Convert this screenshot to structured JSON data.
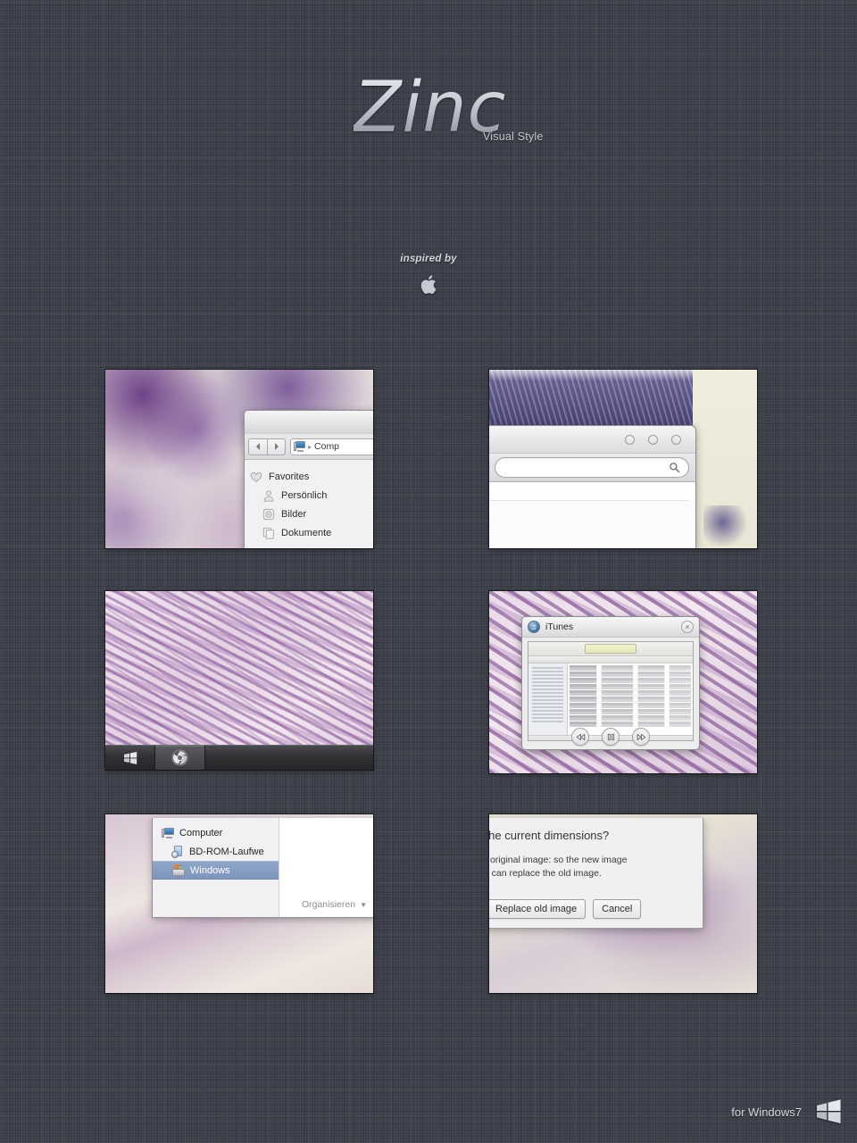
{
  "header": {
    "title": "Zinc",
    "subtitle": "Visual Style"
  },
  "inspired": {
    "label": "inspired by",
    "logo_icon": "apple-logo-icon"
  },
  "footer": {
    "text": "for Windows7",
    "logo_icon": "windows7-flag-icon"
  },
  "colors": {
    "background": "#3b3e48",
    "title_light": "#e9ecf1",
    "title_dark": "#8b909c",
    "selection_blue": "#8fa6c8",
    "taskbar_dark": "#313134"
  },
  "thumbnails": [
    {
      "name": "explorer-window-preview",
      "window": {
        "nav": {
          "back_label": "◀",
          "forward_label": "▶",
          "address_icon": "computer-icon",
          "crumb_separator": "▸",
          "crumb_text": "Comp"
        },
        "sidebar": [
          {
            "label": "Favorites",
            "icon": "heart-icon",
            "indent": false
          },
          {
            "label": "Persönlich",
            "icon": "person-icon",
            "indent": true
          },
          {
            "label": "Bilder",
            "icon": "picture-icon",
            "indent": true
          },
          {
            "label": "Dokumente",
            "icon": "documents-icon",
            "indent": true
          }
        ]
      }
    },
    {
      "name": "browser-window-preview",
      "window": {
        "window_buttons": [
          "minimize-circle",
          "maximize-circle",
          "close-circle"
        ],
        "reload_icon": "reload-icon",
        "omnibox_value": "",
        "omnibox_placeholder": "",
        "search_icon": "search-icon"
      }
    },
    {
      "name": "taskbar-preview",
      "taskbar": {
        "items": [
          {
            "label": "Start",
            "icon": "windows-start-icon",
            "active": false
          },
          {
            "label": "Chrome",
            "icon": "chrome-icon",
            "active": true
          }
        ]
      }
    },
    {
      "name": "itunes-window-preview",
      "window": {
        "title": "iTunes",
        "app_icon": "itunes-icon",
        "close_label": "×",
        "controls": [
          {
            "name": "previous-button",
            "glyph": "⏮"
          },
          {
            "name": "pause-button",
            "glyph": "⏸"
          },
          {
            "name": "next-button",
            "glyph": "⏭"
          }
        ]
      }
    },
    {
      "name": "explorer-tree-preview",
      "window": {
        "tree": [
          {
            "label": "Computer",
            "icon": "computer-icon",
            "sub": false,
            "selected": false
          },
          {
            "label": "BD-ROM-Laufwe",
            "icon": "optical-disc-icon",
            "sub": true,
            "selected": false
          },
          {
            "label": "Windows",
            "icon": "windows-drive-icon",
            "sub": true,
            "selected": true
          }
        ],
        "organize_button": {
          "label": "Organisieren",
          "chevron": "▼"
        }
      }
    },
    {
      "name": "resize-dialog-preview",
      "dialog": {
        "question": "ge to the current dimensions?",
        "line1": "han the original image: so the new image",
        "line2": "sions or can replace the old image.",
        "buttons": [
          {
            "name": "truncated-button",
            "label": ""
          },
          {
            "name": "replace-old-image-button",
            "label": "Replace old image"
          },
          {
            "name": "cancel-button",
            "label": "Cancel"
          }
        ]
      }
    }
  ]
}
